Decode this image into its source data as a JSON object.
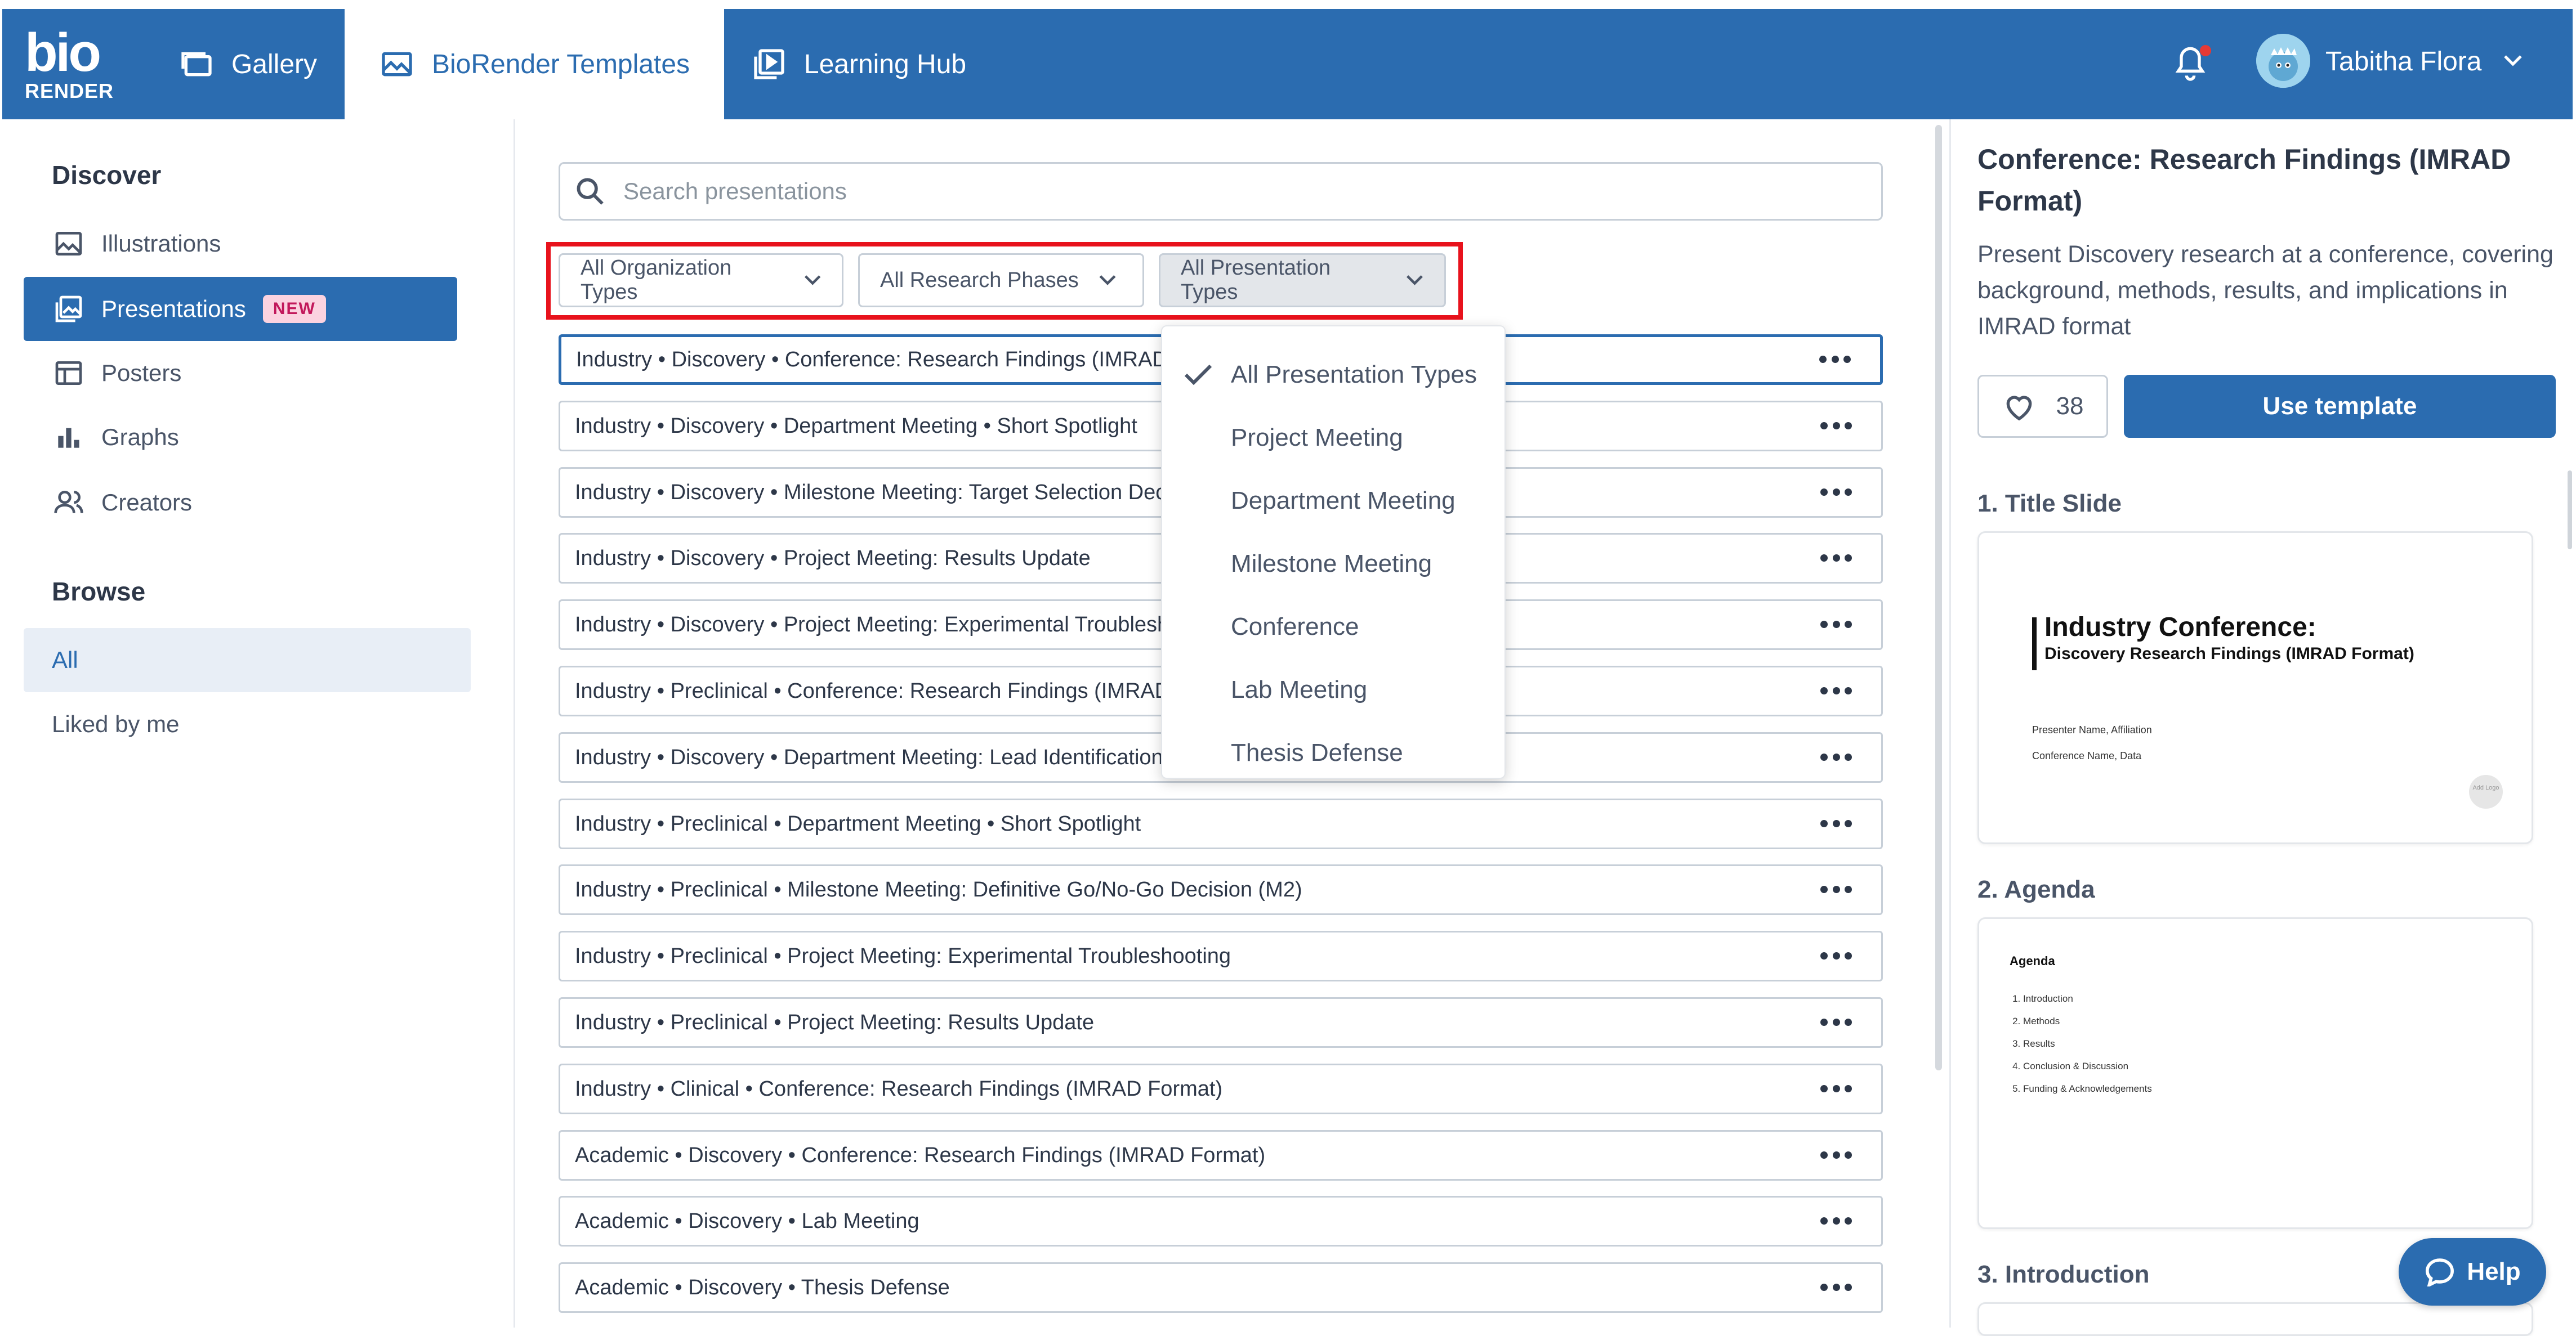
{
  "brand": {
    "logo_top": "bio",
    "logo_bottom": "RENDER"
  },
  "nav": {
    "tabs": [
      {
        "label": "Gallery",
        "icon": "gallery-icon"
      },
      {
        "label": "BioRender Templates",
        "icon": "image-icon",
        "active": true
      },
      {
        "label": "Learning Hub",
        "icon": "play-video-icon"
      }
    ],
    "user_name": "Tabitha Flora",
    "notification_dot": true
  },
  "sidebar": {
    "discover_heading": "Discover",
    "items": [
      {
        "label": "Illustrations",
        "icon": "image-icon"
      },
      {
        "label": "Presentations",
        "icon": "presentation-icon",
        "active": true,
        "badge": "NEW"
      },
      {
        "label": "Posters",
        "icon": "poster-icon"
      },
      {
        "label": "Graphs",
        "icon": "bar-chart-icon"
      },
      {
        "label": "Creators",
        "icon": "users-icon"
      }
    ],
    "browse_heading": "Browse",
    "browse_items": [
      {
        "label": "All",
        "active": true
      },
      {
        "label": "Liked by me"
      }
    ]
  },
  "search": {
    "placeholder": "Search presentations",
    "value": ""
  },
  "filters": [
    {
      "label": "All Organization Types"
    },
    {
      "label": "All Research Phases"
    },
    {
      "label": "All Presentation Types",
      "open": true
    }
  ],
  "dropdown": {
    "items": [
      {
        "label": "All Presentation Types",
        "selected": true
      },
      {
        "label": "Project Meeting"
      },
      {
        "label": "Department Meeting"
      },
      {
        "label": "Milestone Meeting"
      },
      {
        "label": "Conference"
      },
      {
        "label": "Lab Meeting"
      },
      {
        "label": "Thesis Defense"
      }
    ]
  },
  "rows": [
    "Industry • Discovery • Conference: Research Findings (IMRAD Format)",
    "Industry • Discovery • Department Meeting • Short Spotlight",
    "Industry • Discovery • Milestone Meeting: Target Selection Decision (M1)",
    "Industry • Discovery • Project Meeting: Results Update",
    "Industry • Discovery • Project Meeting: Experimental Troubleshooting",
    "Industry • Preclinical • Conference: Research Findings (IMRAD Format)",
    "Industry • Discovery • Department Meeting: Lead Identification",
    "Industry • Preclinical • Department Meeting • Short Spotlight",
    "Industry • Preclinical • Milestone Meeting: Definitive Go/No-Go Decision (M2)",
    "Industry • Preclinical • Project Meeting: Experimental Troubleshooting",
    "Industry • Preclinical • Project Meeting: Results Update",
    "Industry • Clinical • Conference: Research Findings (IMRAD Format)",
    "Academic • Discovery • Conference: Research Findings (IMRAD Format)",
    "Academic • Discovery • Lab Meeting",
    "Academic • Discovery • Thesis Defense"
  ],
  "detail": {
    "title": "Conference: Research Findings (IMRAD Format)",
    "description": "Present Discovery research at a conference, covering background, methods, results, and implications in IMRAD format",
    "likes": "38",
    "use_button": "Use template",
    "slides": [
      {
        "heading": "1. Title Slide",
        "title": "Industry Conference:",
        "subtitle": "Discovery Research Findings (IMRAD Format)",
        "line1": "Presenter Name, Affiliation",
        "line2": "Conference Name, Data",
        "logo_text": "Add Logo"
      },
      {
        "heading": "2. Agenda",
        "title": "Agenda",
        "items": [
          "Introduction",
          "Methods",
          "Results",
          "Conclusion & Discussion",
          "Funding & Acknowledgements"
        ]
      },
      {
        "heading": "3. Introduction"
      }
    ]
  },
  "help": {
    "label": "Help"
  },
  "colors": {
    "primary": "#2b6cb0",
    "highlight": "#e8121c",
    "badge_bg": "#fbd3e0",
    "badge_text": "#c2185b"
  }
}
